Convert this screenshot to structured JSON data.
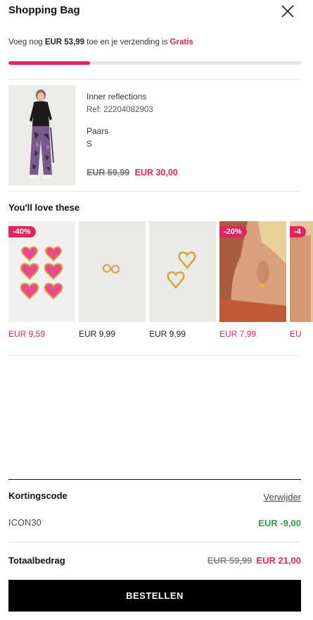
{
  "header": {
    "title": "Shopping Bag"
  },
  "shipping": {
    "prefix": "Voeg nog ",
    "amount": "EUR 53,99",
    "middle": " toe en je verzending is ",
    "free": "Gratis",
    "progress_percent": 28
  },
  "product": {
    "name": "Inner reflections",
    "ref": "Ref: 22204082903",
    "color": "Paars",
    "size": "S",
    "old_price": "EUR 59,99",
    "new_price": "EUR 30,00"
  },
  "recommendations": {
    "title": "You'll love these",
    "items": [
      {
        "badge": "-40%",
        "price": "EUR 9,59",
        "sale": true,
        "icon": "heart-earrings-image"
      },
      {
        "badge": "",
        "price": "EUR 9,99",
        "sale": false,
        "icon": "hoop-earrings-image"
      },
      {
        "badge": "",
        "price": "EUR 9,99",
        "sale": false,
        "icon": "heart-hoops-image"
      },
      {
        "badge": "-20%",
        "price": "EUR 7,99",
        "sale": true,
        "icon": "model-earring-image"
      },
      {
        "badge": "-4",
        "price": "EU",
        "sale": true,
        "icon": "model-partial-image"
      }
    ]
  },
  "discount": {
    "label": "Kortingscode",
    "remove_label": "Verwijder",
    "code": "ICON30",
    "amount": "EUR -9,00"
  },
  "total": {
    "label": "Totaalbedrag",
    "old": "EUR 59,99",
    "new": "EUR 21,00"
  },
  "checkout": {
    "label": "BESTELLEN"
  },
  "colors": {
    "accent": "#e0245e",
    "discount": "#3a9a4a",
    "cta": "#000000"
  }
}
